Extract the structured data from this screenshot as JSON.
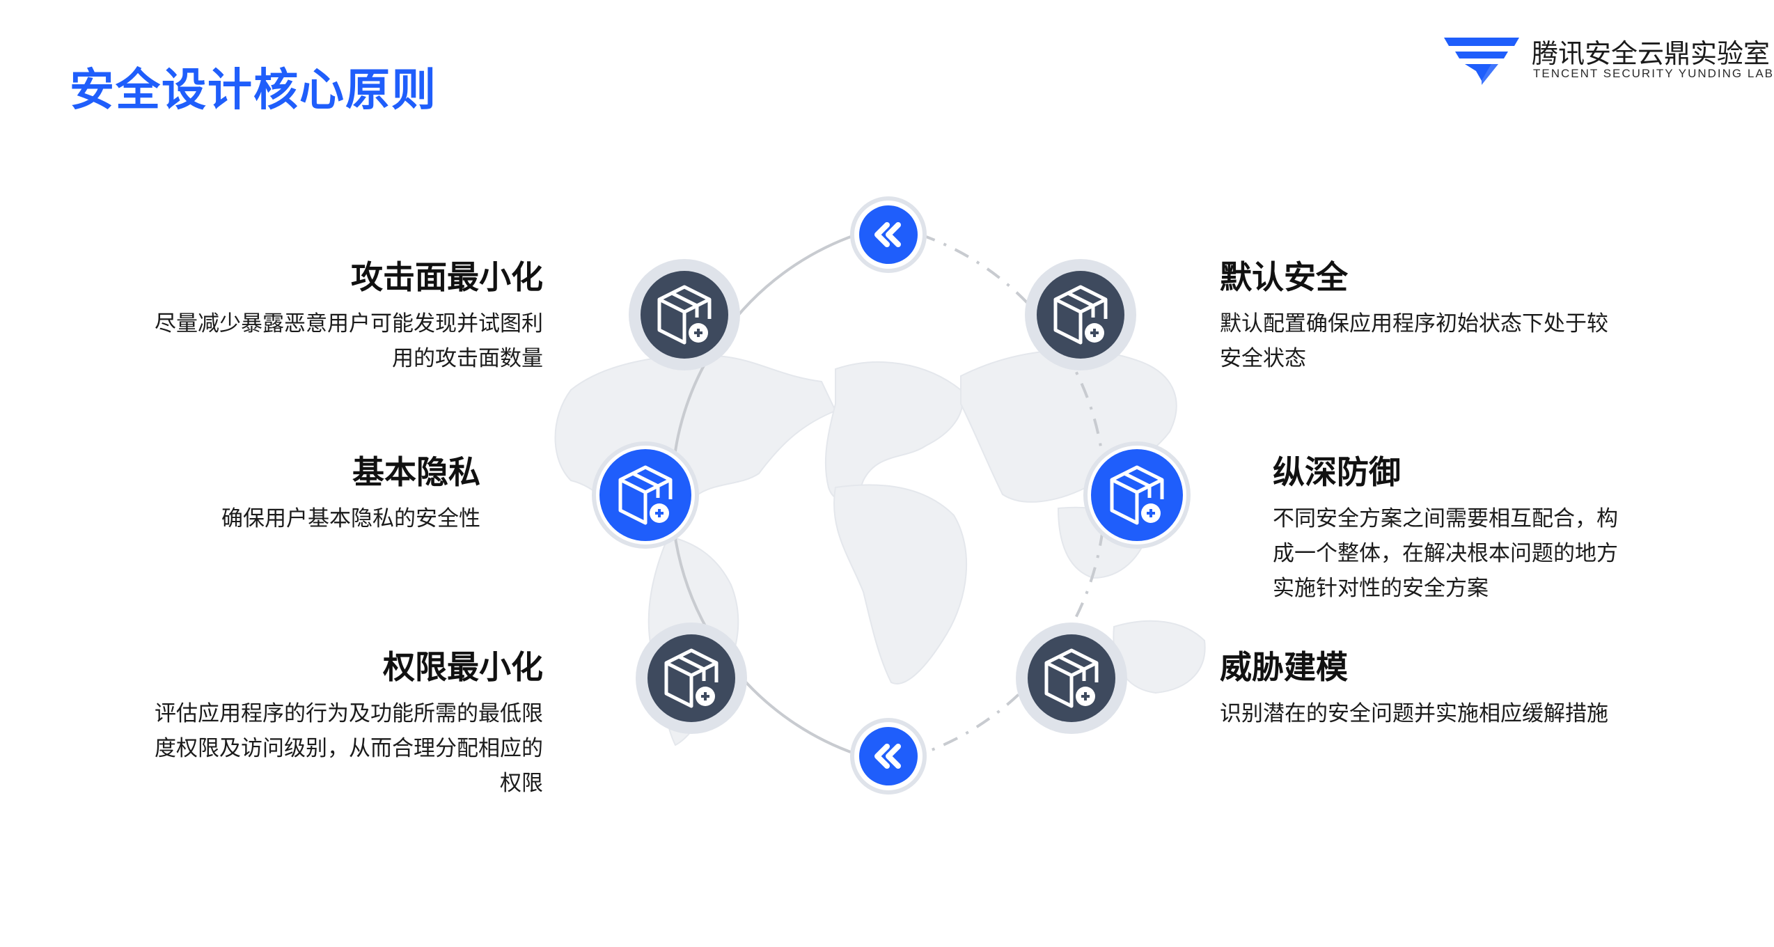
{
  "page": {
    "title": "安全设计核心原则"
  },
  "logo": {
    "name_cn": "腾讯安全云鼎实验室",
    "name_en": "TENCENT SECURITY YUNDING LAB"
  },
  "colors": {
    "accent_blue": "#1f5efb",
    "node_dark": "#3e4a5e",
    "node_ring": "#dfe3ea",
    "orbit_line": "#c8cbd0",
    "map_gray": "#eef0f3"
  },
  "principles": [
    {
      "title": "攻击面最小化",
      "description": "尽量减少暴露恶意用户可能发现并试图利用的攻击面数量",
      "lines": [
        "尽量减少暴露恶意用户可能发现并试图利",
        "用的攻击面数量"
      ]
    },
    {
      "title": "基本隐私",
      "description": "确保用户基本隐私的安全性",
      "lines": [
        "确保用户基本隐私的安全性"
      ]
    },
    {
      "title": "权限最小化",
      "description": "评估应用程序的行为及功能所需的最低限度权限及访问级别，从而合理分配相应的权限",
      "lines": [
        "评估应用程序的行为及功能所需的最低限",
        "度权限及访问级别，从而合理分配相应的",
        "权限"
      ]
    },
    {
      "title": "默认安全",
      "description": "默认配置确保应用程序初始状态下处于较安全状态",
      "lines": [
        "默认配置确保应用程序初始状态下处于较",
        "安全状态"
      ]
    },
    {
      "title": "纵深防御",
      "description": "不同安全方案之间需要相互配合，构成一个整体，在解决根本问题的地方实施针对性的安全方案",
      "lines": [
        "不同安全方案之间需要相互配合，构",
        "成一个整体，在解决根本问题的地方",
        "实施针对性的安全方案"
      ]
    },
    {
      "title": "威胁建模",
      "description": "识别潜在的安全问题并实施相应缓解措施",
      "lines": [
        "识别潜在的安全问题并实施相应缓解措施"
      ]
    }
  ],
  "icons": {
    "node": "box-plus-icon",
    "arrow": "double-chevron-left-icon",
    "map": "world-map-icon",
    "logo": "shield-logo-icon"
  }
}
